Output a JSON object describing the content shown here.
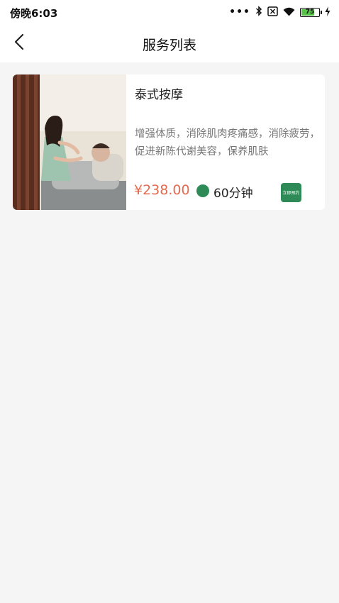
{
  "status_bar": {
    "time": "傍晚6:03",
    "battery_level": "75",
    "icons": [
      "more-dots-icon",
      "bluetooth-icon",
      "sim-off-icon",
      "wifi-icon",
      "battery-icon",
      "charging-icon"
    ]
  },
  "nav": {
    "back_icon": "chevron-left-icon",
    "title": "服务列表"
  },
  "services": [
    {
      "name": "泰式按摩",
      "description": "增强体质，消除肌肉疼痛感，消除疲劳，促进新陈代谢美容，保养肌肤",
      "price": "¥238.00",
      "duration": "60分钟",
      "book_label": "立即预约",
      "image": "massage-photo"
    }
  ],
  "colors": {
    "accent_green": "#2e8b57",
    "price_red": "#e36a4f",
    "page_background": "#f5f5f5"
  }
}
